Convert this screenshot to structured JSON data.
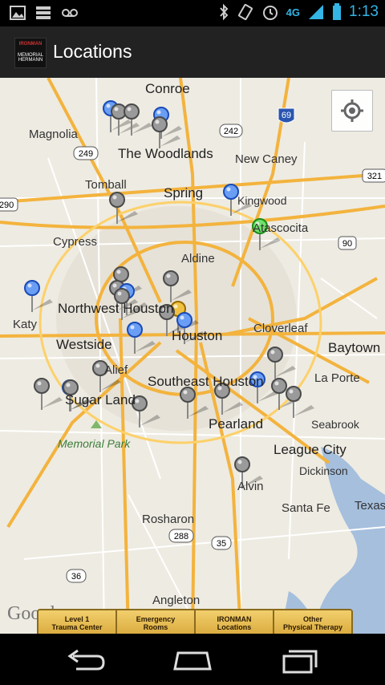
{
  "status_bar": {
    "time": "1:13",
    "network": "4G",
    "notification_icons": [
      "gallery-icon",
      "storage-icon",
      "voicemail-icon"
    ],
    "system_icons": [
      "bluetooth-icon",
      "vibrate-icon",
      "alarm-icon",
      "signal-icon",
      "battery-icon"
    ]
  },
  "action_bar": {
    "title": "Locations",
    "logo_text_top": "IRONMAN",
    "logo_text_bottom": "MEMORIAL HERMANN"
  },
  "map": {
    "attribution": "Google",
    "places": [
      {
        "name": "Conroe",
        "style": "big"
      },
      {
        "name": "Magnolia",
        "style": ""
      },
      {
        "name": "The Woodlands",
        "style": "big"
      },
      {
        "name": "New Caney",
        "style": ""
      },
      {
        "name": "Tomball",
        "style": ""
      },
      {
        "name": "Spring",
        "style": "big"
      },
      {
        "name": "Kingwood",
        "style": "small"
      },
      {
        "name": "Atascocita",
        "style": ""
      },
      {
        "name": "Cypress",
        "style": ""
      },
      {
        "name": "Aldine",
        "style": ""
      },
      {
        "name": "Northwest Houston",
        "style": "big"
      },
      {
        "name": "Katy",
        "style": ""
      },
      {
        "name": "Westside",
        "style": "big"
      },
      {
        "name": "Houston",
        "style": "big"
      },
      {
        "name": "Cloverleaf",
        "style": ""
      },
      {
        "name": "Baytown",
        "style": "big"
      },
      {
        "name": "Alief",
        "style": ""
      },
      {
        "name": "Southeast Houston",
        "style": "big"
      },
      {
        "name": "La Porte",
        "style": ""
      },
      {
        "name": "Sugar Land",
        "style": "big"
      },
      {
        "name": "Pearland",
        "style": "big"
      },
      {
        "name": "Seabrook",
        "style": "small"
      },
      {
        "name": "Memorial Park",
        "style": "park"
      },
      {
        "name": "League City",
        "style": "big"
      },
      {
        "name": "Dickinson",
        "style": ""
      },
      {
        "name": "Alvin",
        "style": ""
      },
      {
        "name": "Santa Fe",
        "style": ""
      },
      {
        "name": "Texas",
        "style": ""
      },
      {
        "name": "Rosharon",
        "style": ""
      },
      {
        "name": "Angleton",
        "style": ""
      }
    ],
    "highway_shields": [
      "242",
      "69",
      "249",
      "321",
      "290",
      "90",
      "288",
      "35",
      "36"
    ],
    "marker_legend": {
      "gray": "Other Physical Therapy",
      "blue": "IRONMAN Locations",
      "green": "Emergency Rooms",
      "gold": "Level 1 Trauma Center"
    }
  },
  "tabs": [
    {
      "line1": "Level 1",
      "line2": "Trauma Center"
    },
    {
      "line1": "Emergency",
      "line2": "Rooms"
    },
    {
      "line1": "IRONMAN",
      "line2": "Locations"
    },
    {
      "line1": "Other",
      "line2": "Physical Therapy"
    }
  ],
  "nav_bar": {
    "buttons": [
      "back-icon",
      "home-icon",
      "recent-apps-icon"
    ]
  }
}
